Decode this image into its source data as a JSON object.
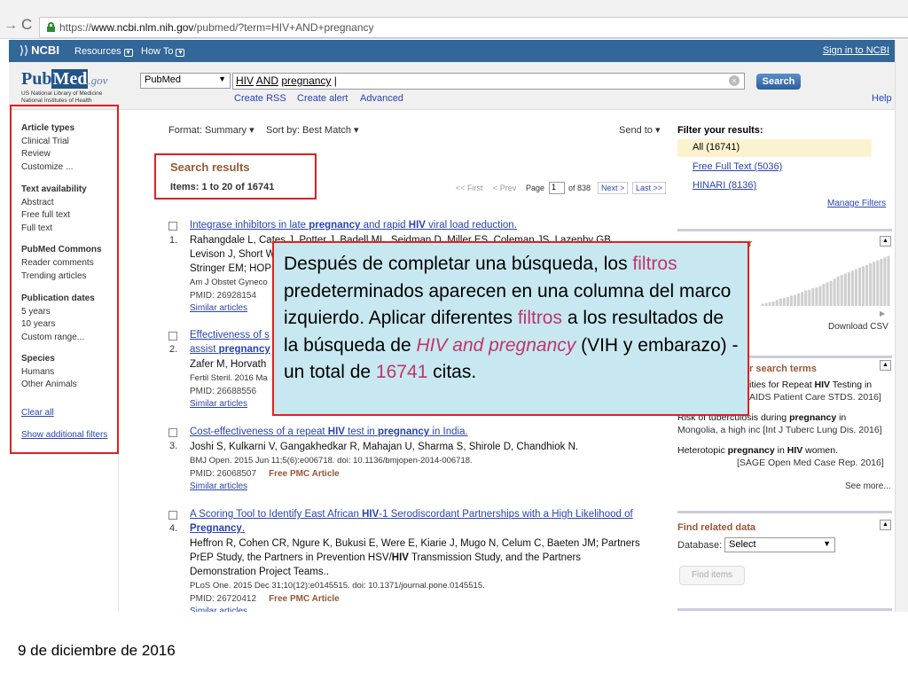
{
  "browser": {
    "url_prefix": "https://",
    "url_domain": "www.ncbi.nlm.nih.gov",
    "url_path": "/pubmed/?term=HIV+AND+pregnancy"
  },
  "ncbi_header": {
    "logo": "NCBI",
    "resources": "Resources",
    "how_to": "How To",
    "sign_in": "Sign in to NCBI"
  },
  "search": {
    "logo_main": "Pub",
    "logo_med": "Med",
    "logo_gov": ".gov",
    "logo_sub1": "US National Library of Medicine",
    "logo_sub2": "National Institutes of Health",
    "database": "PubMed",
    "query_part1": "HIV",
    "query_part2": "AND",
    "query_part3": "pregnancy",
    "button": "Search",
    "create_rss": "Create RSS",
    "create_alert": "Create alert",
    "advanced": "Advanced",
    "help": "Help"
  },
  "sidebar": {
    "article_types": "Article types",
    "clinical_trial": "Clinical Trial",
    "review": "Review",
    "customize": "Customize ...",
    "text_availability": "Text availability",
    "abstract": "Abstract",
    "free_full_text": "Free full text",
    "full_text": "Full text",
    "pubmed_commons": "PubMed Commons",
    "reader_comments": "Reader comments",
    "trending_articles": "Trending articles",
    "publication_dates": "Publication dates",
    "five_years": "5 years",
    "ten_years": "10 years",
    "custom_range": "Custom range...",
    "species": "Species",
    "humans": "Humans",
    "other_animals": "Other Animals",
    "clear_all": "Clear all",
    "show_additional": "Show additional filters"
  },
  "results_header": {
    "format_label": "Format:",
    "format_value": "Summary",
    "sort_label": "Sort by:",
    "sort_value": "Best Match",
    "send_to": "Send to",
    "title": "Search results",
    "items": "Items: 1 to 20 of 16741",
    "first": "<< First",
    "prev": "< Prev",
    "page_label": "Page",
    "page_value": "1",
    "of_pages": "of 838",
    "next": "Next >",
    "last": "Last >>"
  },
  "results": [
    {
      "num": "1.",
      "t1": "Integrase inhibitors in late ",
      "t2": "pregnancy",
      "t3": " and rapid ",
      "t4": "HIV",
      "t5": " viral load reduction.",
      "authors1": "Rahangdale L, Cates J, Potter J, Badell ML, Seidman D, Miller ES, Coleman JS, Lazenby GB,",
      "authors2": "Levison J, Short W",
      "authors3": "Stringer EM; HOPE",
      "source": "Am J Obstet Gyneco",
      "pmid": "PMID: 26928154",
      "similar": "Similar articles"
    },
    {
      "num": "2.",
      "t1": "Effectiveness of s",
      "t2_title": "assist ",
      "t3_title": "pregnancy",
      "authors1": "Zafer M, Horvath",
      "source": "Fertil Steril. 2016 Ma",
      "pmid": "PMID: 26688556",
      "similar": "Similar articles"
    },
    {
      "num": "3.",
      "t1": "Cost-effectiveness of a repeat ",
      "t2": "HIV",
      "t3": " test in ",
      "t4": "pregnancy",
      "t5": " in India.",
      "authors1": "Joshi S, Kulkarni V, Gangakhedkar R, Mahajan U, Sharma S, Shirole D, Chandhiok N.",
      "source": "BMJ Open. 2015 Jun 11;5(6):e006718. doi: 10.1136/bmjopen-2014-006718.",
      "pmid": "PMID: 26068507",
      "free": "Free PMC Article",
      "similar": "Similar articles"
    },
    {
      "num": "4.",
      "t1": "A Scoring Tool to Identify East African ",
      "t2": "HIV",
      "t3": "-1 Serodiscordant Partnerships with a High Likelihood of",
      "t4": "Pregnancy",
      "t5": ".",
      "authors1": "Heffron R, Cohen CR, Ngure K, Bukusi E, Were E, Kiarie J, Mugo N, Celum C, Baeten JM; Partners",
      "authors2a": "PrEP Study, the Partners in Prevention HSV/",
      "authors2b": "HIV",
      "authors2c": " Transmission Study, and the Partners",
      "authors3": "Demonstration Project Teams..",
      "source": "PLoS One. 2015 Dec 31;10(12):e0145515. doi: 10.1371/journal.pone.0145515.",
      "pmid": "PMID: 26720412",
      "free": "Free PMC Article",
      "similar": "Similar articles"
    }
  ],
  "filters": {
    "title": "Filter your results:",
    "all": "All (16741)",
    "free_full_text": "Free Full Text (5036)",
    "hinari": "HINARI (8136)",
    "manage": "Manage Filters"
  },
  "right_panels": {
    "year_title": "Results by year",
    "year_title_visible": "r",
    "download_csv": "Download CSV",
    "terms_title": "r search terms",
    "rel1_line1a": "ities for Repeat ",
    "rel1_line1b": "HIV",
    "rel1_line1c": " Testing in",
    "rel1_line2": "AIDS Patient Care STDS. 2016]",
    "rel2_line1a": "Risk of tuberculosis during ",
    "rel2_line1b": "pregnancy",
    "rel2_line1c": " in",
    "rel2_line2a": "Mongolia, a high inc",
    "rel2_line2b": "[Int J Tuberc Lung Dis. 2016]",
    "rel3_line1a": "Heterotopic ",
    "rel3_line1b": "pregnancy",
    "rel3_line1c": " in ",
    "rel3_line1d": "HIV",
    "rel3_line1e": " women.",
    "rel3_line2": "[SAGE Open Med Case Rep. 2016]",
    "see_more": "See more...",
    "related_title": "Find related data",
    "database_label": "Database:",
    "database_value": "Select",
    "find_items": "Find items"
  },
  "callout": {
    "p1": "Después de completar una búsqueda, los ",
    "filtros1": "filtros",
    "p2": " predeterminados aparecen en una columna del marco izquierdo. Aplicar diferentes ",
    "filtros2": "filtros",
    "p3": " a los resultados de la búsqueda de ",
    "query": "HIV and pregnancy",
    "p4": " (VIH y embarazo) - un total de ",
    "count": "16741",
    "p5": " citas."
  },
  "footer": {
    "date": "9 de diciembre de 2016"
  },
  "year_chart": {
    "values": [
      3,
      4,
      5,
      6,
      8,
      10,
      11,
      12,
      14,
      15,
      17,
      19,
      21,
      22,
      24,
      25,
      27,
      30,
      32,
      34,
      37,
      40,
      42,
      44,
      46,
      48,
      50,
      52,
      54,
      56,
      58,
      60,
      62,
      64,
      66,
      68
    ],
    "bar_color": "#cfcfcf",
    "max": 70
  }
}
